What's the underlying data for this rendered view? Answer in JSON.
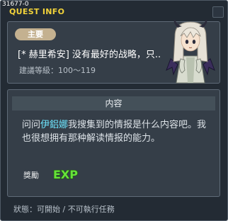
{
  "window": {
    "id": "31677-0",
    "title": "QUEST INFO"
  },
  "quest": {
    "category": "主要",
    "name": "[* 赫里希安] 没有最好的战略，只..",
    "level": "建議等級：100～119"
  },
  "content": {
    "header": "内容",
    "text_before": "问问",
    "npc_name": "伊鋁娜",
    "text_after": "我搜集到的情报是什么内容吧。我也很想拥有那种解读情报的能力。"
  },
  "reward": {
    "label": "獎勵",
    "exp_label": "EXP"
  },
  "status": {
    "text": "狀態：可開始 / 不可執行任務"
  },
  "colors": {
    "title": "#f2d33a",
    "npc_link": "#6ee6ff",
    "exp_green": "#66e23a",
    "badge": "#c4b190"
  }
}
